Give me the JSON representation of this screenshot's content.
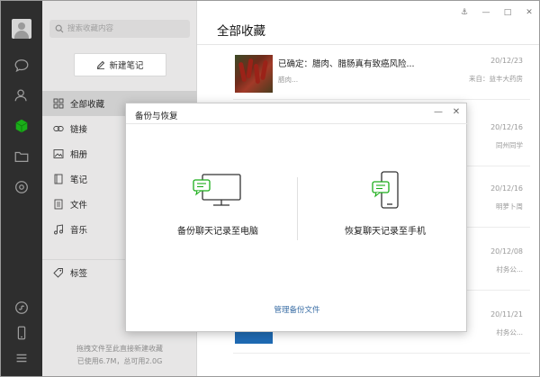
{
  "app": {
    "search_placeholder": "搜索收藏内容",
    "new_note_label": "新建笔记",
    "nav": [
      {
        "label": "全部收藏",
        "icon": "grid-icon",
        "active": true
      },
      {
        "label": "链接",
        "icon": "link-icon",
        "active": false
      },
      {
        "label": "相册",
        "icon": "image-icon",
        "active": false
      },
      {
        "label": "笔记",
        "icon": "note-icon",
        "active": false
      },
      {
        "label": "文件",
        "icon": "file-icon",
        "active": false
      },
      {
        "label": "音乐",
        "icon": "music-icon",
        "active": false
      }
    ],
    "tags_label": "标签",
    "footer_line1": "拖拽文件至此直接新建收藏",
    "footer_line2": "已使用6.7M，总可用2.0G"
  },
  "main": {
    "title": "全部收藏",
    "items": [
      {
        "title": "已确定：腊肉、腊肠真有致癌风险...",
        "subtitle": "腊肉...",
        "date": "20/12/23",
        "source": "来自：益丰大药房"
      },
      {
        "title": "",
        "subtitle": "",
        "date": "20/12/16",
        "source": "同州同学"
      },
      {
        "title": "",
        "subtitle": "",
        "date": "20/12/16",
        "source": "明萝卜周"
      },
      {
        "title": "",
        "subtitle": "",
        "date": "20/12/08",
        "source": "村务公..."
      },
      {
        "title": "",
        "subtitle": "",
        "date": "20/11/21",
        "source": "村务公..."
      }
    ]
  },
  "dialog": {
    "title": "备份与恢复",
    "option_backup": "备份聊天记录至电脑",
    "option_restore": "恢复聊天记录至手机",
    "manage_link": "管理备份文件"
  },
  "colors": {
    "rail": "#2e2e2e",
    "sidebar": "#e7e6e6",
    "accent_green": "#1aad19",
    "link_blue": "#3a6ea5"
  }
}
